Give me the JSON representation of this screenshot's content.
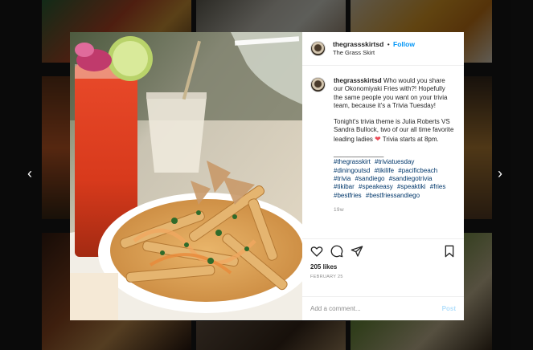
{
  "navigation": {
    "prev_glyph": "‹",
    "next_glyph": "›"
  },
  "post": {
    "username": "thegrassskirtsd",
    "separator": "•",
    "follow_label": "Follow",
    "location": "The Grass Skirt",
    "caption_p1": "Who would you share our Okonomiyaki Fries with?! Hopefully the same people you want on your trivia team, because it's a Trivia Tuesday!",
    "caption_p2_before": "Tonight's trivia theme is Julia Roberts VS Sandra Bullock, two of our all time favorite leading ladies",
    "caption_p2_after": "Trivia starts at 8pm.",
    "heart_emoji": "❤",
    "caption_separator": "______________",
    "hashtags": [
      "#thegrasskirt",
      "#triviatuesday",
      "#diningoutsd",
      "#tikilife",
      "#pacificbeach",
      "#trivia",
      "#sandiego",
      "#sandiegotrivia",
      "#tikibar",
      "#speakeasy",
      "#speaktiki",
      "#fries",
      "#bestfries",
      "#bestfriessandiego"
    ],
    "age": "19w",
    "likes": "205 likes",
    "date": "FEBRUARY 25",
    "comment_placeholder": "Add a comment...",
    "post_label": "Post",
    "icons": {
      "like": "heart-icon",
      "comment": "comment-icon",
      "share": "share-icon",
      "save": "bookmark-icon"
    }
  },
  "colors": {
    "follow": "#0095f6",
    "post_disabled": "#b2dffc",
    "text": "#262626",
    "muted": "#8e8e8e"
  }
}
